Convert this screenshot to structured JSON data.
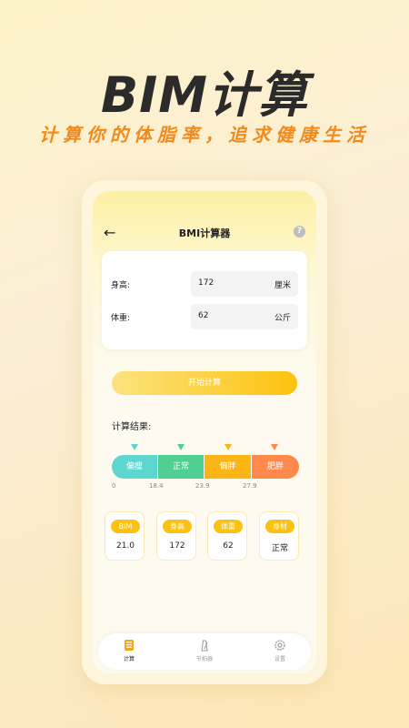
{
  "hero": {
    "title": "BIM计算",
    "subtitle": "计算你的体脂率，追求健康生活"
  },
  "header": {
    "title": "BMI计算器",
    "help": "?"
  },
  "inputs": {
    "height": {
      "label": "身高:",
      "value": "172",
      "unit": "厘米"
    },
    "weight": {
      "label": "体重:",
      "value": "62",
      "unit": "公斤"
    }
  },
  "start_button": "开始计算",
  "result_label": "计算结果:",
  "scale": {
    "segments": [
      "偏瘦",
      "正常",
      "偏胖",
      "肥胖"
    ],
    "ticks": [
      "0",
      "18.4",
      "23.9",
      "27.9"
    ],
    "colors": [
      "#5ed6d0",
      "#4fcf92",
      "#fbb517",
      "#ff8a4c"
    ]
  },
  "stats": [
    {
      "label": "BIM",
      "value": "21.0"
    },
    {
      "label": "身高",
      "value": "172"
    },
    {
      "label": "体重",
      "value": "62"
    },
    {
      "label": "身材",
      "value": "正常"
    }
  ],
  "tabs": [
    {
      "label": "计算",
      "icon": "calculator-icon",
      "active": true
    },
    {
      "label": "节拍器",
      "icon": "metronome-icon",
      "active": false
    },
    {
      "label": "设置",
      "icon": "gear-icon",
      "active": false
    }
  ],
  "colors": {
    "accent": "#fcc113",
    "subtitle": "#f08a1c"
  }
}
